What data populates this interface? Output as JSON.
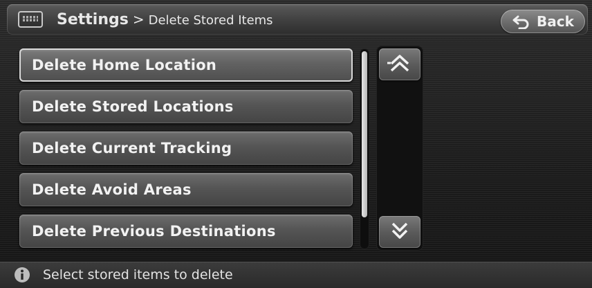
{
  "header": {
    "breadcrumb_root": "Settings",
    "breadcrumb_separator": ">",
    "breadcrumb_page": "Delete Stored Items",
    "keyboard_icon": "keyboard-icon",
    "back_label": "Back",
    "back_icon": "return-arrow-icon"
  },
  "list": {
    "items": [
      {
        "label": "Delete Home Location",
        "selected": true
      },
      {
        "label": "Delete Stored Locations",
        "selected": false
      },
      {
        "label": "Delete Current Tracking",
        "selected": false
      },
      {
        "label": "Delete Avoid Areas",
        "selected": false
      },
      {
        "label": "Delete Previous Destinations",
        "selected": false
      }
    ]
  },
  "pager": {
    "up_icon": "double-chevron-up-icon",
    "down_icon": "double-chevron-down-icon"
  },
  "status": {
    "icon": "info-icon",
    "message": "Select stored items to delete"
  },
  "colors": {
    "background": "#1a1a1a",
    "button": "#555555",
    "text": "#f2f2f2"
  }
}
